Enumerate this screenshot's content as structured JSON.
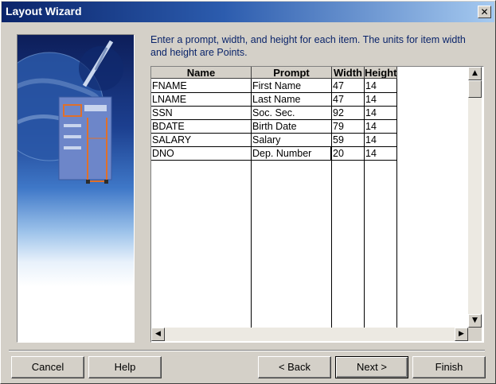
{
  "window": {
    "title": "Layout Wizard",
    "close_glyph": "✕"
  },
  "instructions": "Enter a prompt, width, and height for each item. The units for item width and height are Points.",
  "table": {
    "columns": [
      "Name",
      "Prompt",
      "Width",
      "Height"
    ],
    "rows": [
      {
        "name": "FNAME",
        "prompt": "First Name",
        "width": "47",
        "height": "14"
      },
      {
        "name": "LNAME",
        "prompt": "Last Name",
        "width": "47",
        "height": "14"
      },
      {
        "name": "SSN",
        "prompt": "Soc. Sec.",
        "width": "92",
        "height": "14"
      },
      {
        "name": "BDATE",
        "prompt": "Birth Date",
        "width": "79",
        "height": "14"
      },
      {
        "name": "SALARY",
        "prompt": "Salary",
        "width": "59",
        "height": "14"
      },
      {
        "name": "DNO",
        "prompt": "Dep. Number",
        "width": "20",
        "height": "14"
      }
    ]
  },
  "scrollbars": {
    "up": "▲",
    "down": "▼",
    "left": "◀",
    "right": "▶"
  },
  "buttons": {
    "cancel": "Cancel",
    "help": "Help",
    "back": "< Back",
    "next": "Next >",
    "finish": "Finish"
  },
  "icons": {
    "close": "close-icon",
    "wizard_art": "globe-form-illustration"
  },
  "colors": {
    "title_bar": "#0a246a",
    "instruction_text": "#0a246a",
    "face": "#d4d0c8"
  }
}
